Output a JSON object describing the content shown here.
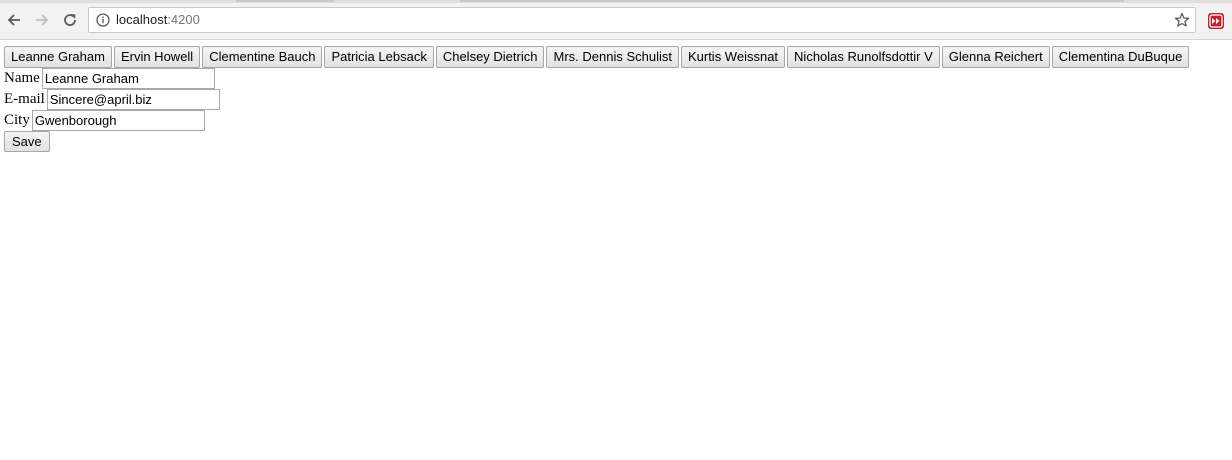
{
  "browser": {
    "url_host": "localhost",
    "url_port": ":4200",
    "icons": {
      "back": "back-arrow-icon",
      "forward": "forward-arrow-icon",
      "reload": "reload-icon",
      "info": "info-icon",
      "bookmark": "star-icon",
      "extension": "extension-icon"
    },
    "extension_color": "#c8202a"
  },
  "users": [
    {
      "label": "Leanne Graham"
    },
    {
      "label": "Ervin Howell"
    },
    {
      "label": "Clementine Bauch"
    },
    {
      "label": "Patricia Lebsack"
    },
    {
      "label": "Chelsey Dietrich"
    },
    {
      "label": "Mrs. Dennis Schulist"
    },
    {
      "label": "Kurtis Weissnat"
    },
    {
      "label": "Nicholas Runolfsdottir V"
    },
    {
      "label": "Glenna Reichert"
    },
    {
      "label": "Clementina DuBuque"
    }
  ],
  "form": {
    "name_label": "Name",
    "name_value": "Leanne Graham",
    "email_label": "E-mail",
    "email_value": "Sincere@april.biz",
    "city_label": "City",
    "city_value": "Gwenborough",
    "save_label": "Save"
  }
}
